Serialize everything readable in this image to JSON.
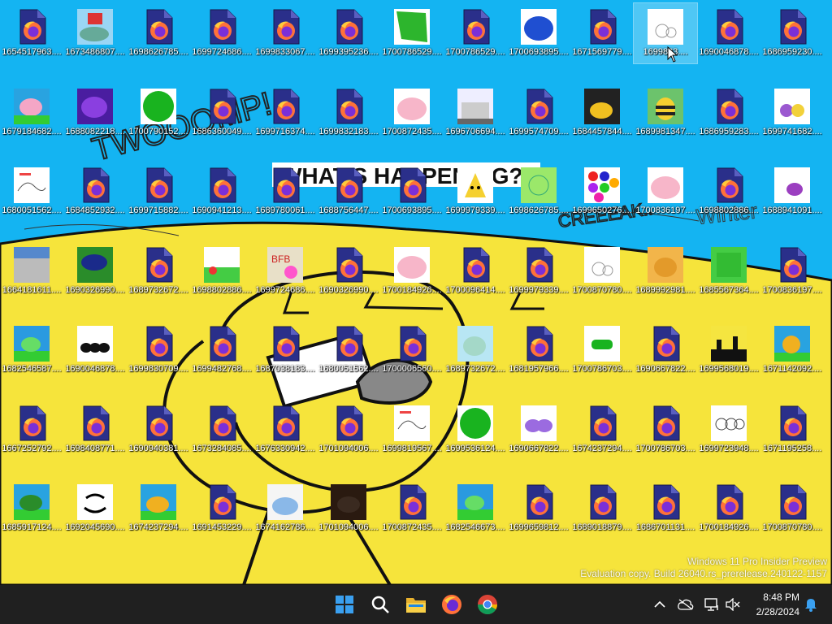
{
  "desktop": {
    "icons": [
      {
        "label": "1654517963....",
        "kind": "firefox"
      },
      {
        "label": "1673486807....",
        "kind": "pic_robot"
      },
      {
        "label": "1698626785....",
        "kind": "firefox"
      },
      {
        "label": "1699724686....",
        "kind": "firefox"
      },
      {
        "label": "1699833067....",
        "kind": "firefox"
      },
      {
        "label": "1699395236....",
        "kind": "firefox"
      },
      {
        "label": "1700786529....",
        "kind": "pic_green"
      },
      {
        "label": "1700786529....",
        "kind": "firefox"
      },
      {
        "label": "1700693895....",
        "kind": "pic_blueblob"
      },
      {
        "label": "1671569779....",
        "kind": "firefox"
      },
      {
        "label": "1699833....",
        "kind": "pic_white"
      },
      {
        "label": "1690046878....",
        "kind": "firefox"
      },
      {
        "label": "1686959230....",
        "kind": "firefox"
      },
      {
        "label": "1679184682....",
        "kind": "pic_pinkpig"
      },
      {
        "label": "1688082218....",
        "kind": "pic_purple"
      },
      {
        "label": "1700790152....",
        "kind": "pic_greencircle"
      },
      {
        "label": "1686360049....",
        "kind": "firefox"
      },
      {
        "label": "1699716374....",
        "kind": "firefox"
      },
      {
        "label": "1699832183....",
        "kind": "firefox"
      },
      {
        "label": "1700872435....",
        "kind": "pic_pinkblob"
      },
      {
        "label": "1696706694....",
        "kind": "pic_house"
      },
      {
        "label": "1699574709....",
        "kind": "firefox"
      },
      {
        "label": "1684457844....",
        "kind": "pic_duck"
      },
      {
        "label": "1689981347....",
        "kind": "pic_bee"
      },
      {
        "label": "1686959283....",
        "kind": "firefox"
      },
      {
        "label": "1699741682....",
        "kind": "pic_fruit"
      },
      {
        "label": "1680051562....",
        "kind": "pic_sketch"
      },
      {
        "label": "1684852932....",
        "kind": "firefox"
      },
      {
        "label": "1699715882....",
        "kind": "firefox"
      },
      {
        "label": "1690941213....",
        "kind": "firefox"
      },
      {
        "label": "1689780061....",
        "kind": "firefox"
      },
      {
        "label": "1688756447....",
        "kind": "firefox"
      },
      {
        "label": "1700693895....",
        "kind": "firefox"
      },
      {
        "label": "1699979339....",
        "kind": "pic_pikachu"
      },
      {
        "label": "1698626785....",
        "kind": "pic_limeface"
      },
      {
        "label": "1699650276....",
        "kind": "pic_dots"
      },
      {
        "label": "1700836197....",
        "kind": "pic_pinkblob"
      },
      {
        "label": "1698802886....",
        "kind": "firefox"
      },
      {
        "label": "1688941091....",
        "kind": "pic_whitepurple"
      },
      {
        "label": "1664181611....",
        "kind": "pic_grey"
      },
      {
        "label": "1690326990....",
        "kind": "pic_darkblue"
      },
      {
        "label": "1689732672....",
        "kind": "firefox"
      },
      {
        "label": "1698802886....",
        "kind": "pic_landscape"
      },
      {
        "label": "1699724686....",
        "kind": "pic_bfb"
      },
      {
        "label": "1690326990....",
        "kind": "firefox"
      },
      {
        "label": "1700184926....",
        "kind": "pic_pinkblob"
      },
      {
        "label": "1700096414....",
        "kind": "firefox"
      },
      {
        "label": "1699979339....",
        "kind": "firefox"
      },
      {
        "label": "1700870780....",
        "kind": "pic_white"
      },
      {
        "label": "1689992981....",
        "kind": "pic_cat"
      },
      {
        "label": "1685567364....",
        "kind": "pic_greensq"
      },
      {
        "label": "1700836197....",
        "kind": "firefox"
      },
      {
        "label": "1682546587....",
        "kind": "pic_frog"
      },
      {
        "label": "1690046878....",
        "kind": "pic_blackblobs"
      },
      {
        "label": "1699830709....",
        "kind": "firefox"
      },
      {
        "label": "1699482768....",
        "kind": "firefox"
      },
      {
        "label": "1687038183....",
        "kind": "firefox"
      },
      {
        "label": "1680051562....",
        "kind": "firefox"
      },
      {
        "label": "1700006560....",
        "kind": "firefox"
      },
      {
        "label": "1689732672....",
        "kind": "pic_lightblue"
      },
      {
        "label": "1681957966....",
        "kind": "firefox"
      },
      {
        "label": "1700786703....",
        "kind": "pic_greencar"
      },
      {
        "label": "1690667822....",
        "kind": "firefox"
      },
      {
        "label": "1699568019....",
        "kind": "pic_city"
      },
      {
        "label": "1671142092....",
        "kind": "pic_lion"
      },
      {
        "label": "1667252792....",
        "kind": "firefox"
      },
      {
        "label": "1698408771....",
        "kind": "firefox"
      },
      {
        "label": "1690940381....",
        "kind": "firefox"
      },
      {
        "label": "1673284085....",
        "kind": "firefox"
      },
      {
        "label": "1676330942....",
        "kind": "firefox"
      },
      {
        "label": "1701094006....",
        "kind": "firefox"
      },
      {
        "label": "1699819567....",
        "kind": "pic_sketch"
      },
      {
        "label": "1699536124....",
        "kind": "pic_greencircle"
      },
      {
        "label": "1690667822....",
        "kind": "pic_purpleclouds"
      },
      {
        "label": "1674237294....",
        "kind": "firefox"
      },
      {
        "label": "1700786703....",
        "kind": "firefox"
      },
      {
        "label": "1699723948....",
        "kind": "pic_whiteblobs"
      },
      {
        "label": "1671195258....",
        "kind": "firefox"
      },
      {
        "label": "1685917124....",
        "kind": "pic_turtle"
      },
      {
        "label": "1692045690....",
        "kind": "pic_face"
      },
      {
        "label": "1674237294....",
        "kind": "pic_yellowdog"
      },
      {
        "label": "1691453229....",
        "kind": "firefox"
      },
      {
        "label": "1674162786....",
        "kind": "pic_cloud"
      },
      {
        "label": "1701094006....",
        "kind": "pic_dark"
      },
      {
        "label": "1700872435....",
        "kind": "firefox"
      },
      {
        "label": "1682546673....",
        "kind": "pic_frog"
      },
      {
        "label": "1699659812....",
        "kind": "firefox"
      },
      {
        "label": "1689018879....",
        "kind": "firefox"
      },
      {
        "label": "1686701131....",
        "kind": "firefox"
      },
      {
        "label": "1700184926....",
        "kind": "firefox"
      },
      {
        "label": "1700870780....",
        "kind": "firefox"
      }
    ]
  },
  "wallpaper": {
    "text_twooomp": "TWOOOMP!",
    "text_whats": "WHAT'S HAPPENING?!!",
    "text_creeeak": "CREEEAK..",
    "text_winter": "Winter"
  },
  "watermark": {
    "line1": "Windows 11 Pro Insider Preview",
    "line2": "Evaluation copy. Build 26040.rs_prerelease.240122-1157"
  },
  "taskbar": {
    "time": "8:48 PM",
    "date": "2/28/2024",
    "icons": [
      "start-icon",
      "search-icon",
      "file-explorer-icon",
      "firefox-icon",
      "chrome-icon"
    ],
    "tray_icons": [
      "chevron-up-icon",
      "cloud-icon",
      "network-icon",
      "volume-icon",
      "notification-bell-icon"
    ]
  },
  "colors": {
    "sky": "#14b4f2",
    "ground": "#f6e43b",
    "taskbar": "#202020",
    "accent": "#0078d4"
  }
}
